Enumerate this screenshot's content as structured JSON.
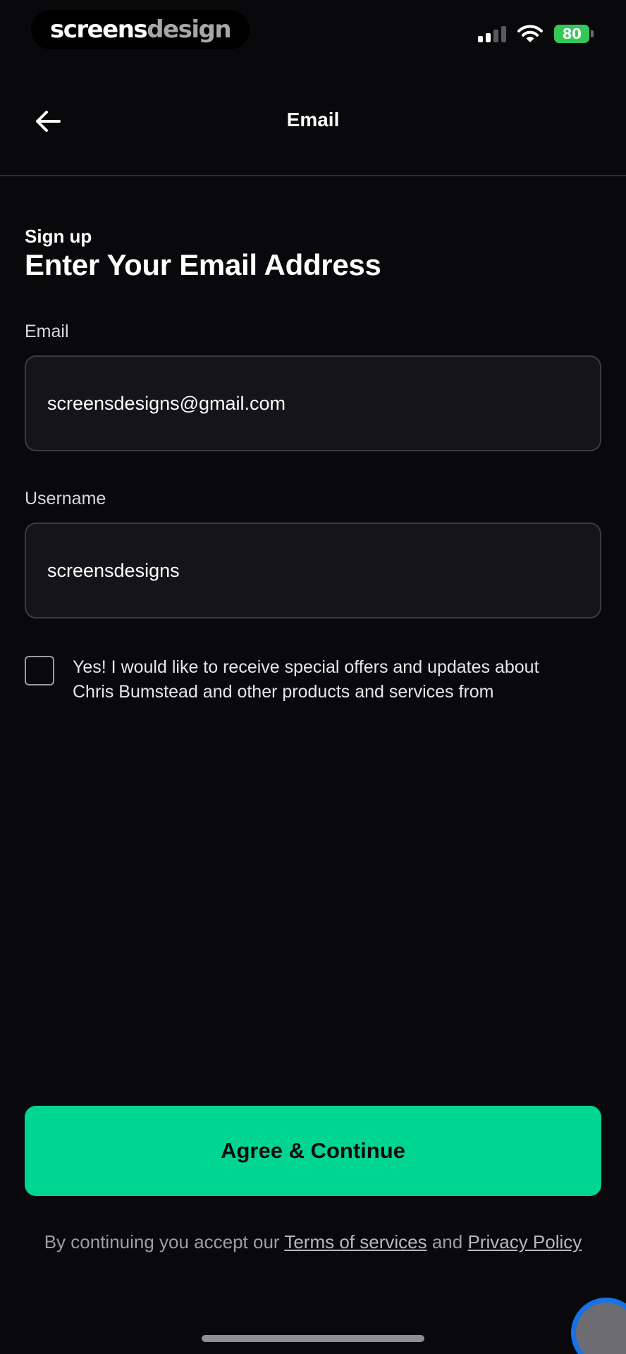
{
  "status_bar": {
    "brand_primary": "screens",
    "brand_secondary": "design",
    "battery": "80"
  },
  "nav": {
    "title": "Email",
    "back_icon": "arrow-left-icon"
  },
  "header": {
    "eyebrow": "Sign up",
    "title": "Enter Your Email Address"
  },
  "form": {
    "email_label": "Email",
    "email_value": "screensdesigns@gmail.com",
    "username_label": "Username",
    "username_value": "screensdesigns",
    "consent_text": "Yes! I would like to receive special offers and updates about Chris Bumstead and other products and services from"
  },
  "cta": {
    "label": "Agree & Continue"
  },
  "legal": {
    "prefix": "By continuing you accept our",
    "terms": "Terms of services",
    "joiner": "and",
    "privacy": "Privacy Policy"
  },
  "colors": {
    "background": "#09080b",
    "accent": "#00d68f",
    "battery": "#34c759"
  }
}
